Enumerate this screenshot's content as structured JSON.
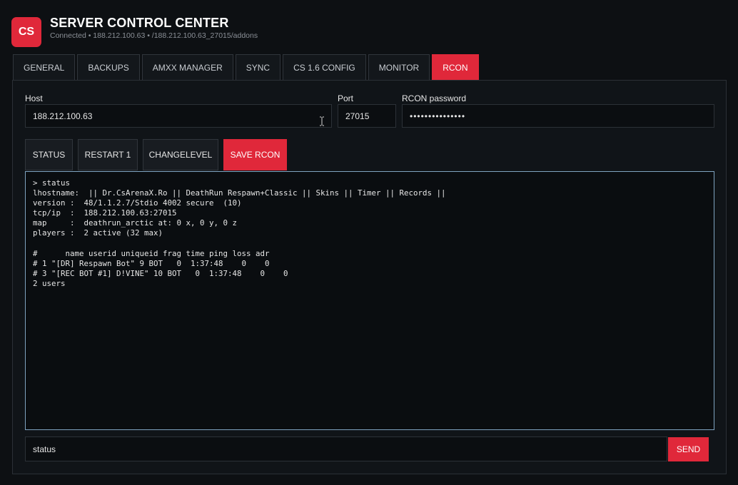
{
  "app": {
    "logo_text": "CS",
    "title": "SERVER CONTROL CENTER",
    "subtitle": "Connected • 188.212.100.63 • /188.212.100.63_27015/addons",
    "accent_color": "#e0283a"
  },
  "tabs": [
    {
      "label": "GENERAL",
      "active": false
    },
    {
      "label": "BACKUPS",
      "active": false
    },
    {
      "label": "AMXX MANAGER",
      "active": false
    },
    {
      "label": "SYNC",
      "active": false
    },
    {
      "label": "CS 1.6 CONFIG",
      "active": false
    },
    {
      "label": "MONITOR",
      "active": false
    },
    {
      "label": "RCON",
      "active": true
    }
  ],
  "rcon": {
    "host_label": "Host",
    "host_value": "188.212.100.63",
    "port_label": "Port",
    "port_value": "27015",
    "password_label": "RCON password",
    "password_value": "•••••••••••••••"
  },
  "actions": {
    "status": "STATUS",
    "restart": "RESTART 1",
    "changelevel": "CHANGELEVEL",
    "save": "SAVE RCON"
  },
  "console": {
    "lines": [
      "> status",
      "lhostname:  || Dr.CsArenaX.Ro || DeathRun Respawn+Classic || Skins || Timer || Records ||",
      "version :  48/1.1.2.7/Stdio 4002 secure  (10)",
      "tcp/ip  :  188.212.100.63:27015",
      "map     :  deathrun_arctic at: 0 x, 0 y, 0 z",
      "players :  2 active (32 max)",
      "",
      "#      name userid uniqueid frag time ping loss adr",
      "# 1 \"[DR] Respawn Bot\" 9 BOT   0  1:37:48    0    0",
      "# 3 \"[REC BOT #1] D!VINE\" 10 BOT   0  1:37:48    0    0",
      "2 users"
    ]
  },
  "command": {
    "value": "status",
    "send_label": "SEND"
  }
}
